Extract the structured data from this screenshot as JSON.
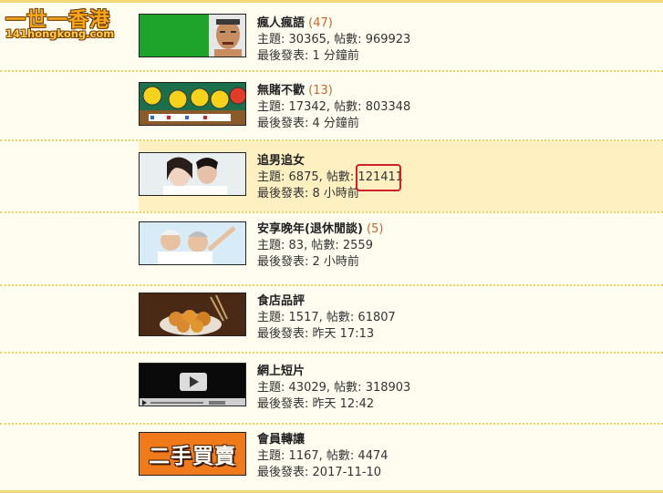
{
  "logo": {
    "main": "一世一香港",
    "sub": "141hongkong.com"
  },
  "labels": {
    "topics": "主題",
    "posts": "帖數",
    "last_post": "最後發表"
  },
  "forums": [
    {
      "name": "瘋人瘋語",
      "new_count": "(47)",
      "topics": "30365",
      "posts": "969923",
      "last_post": "1 分鐘前",
      "thumb": "green-portrait"
    },
    {
      "name": "無賭不歡",
      "new_count": "(13)",
      "topics": "17342",
      "posts": "803348",
      "last_post": "4 分鐘前",
      "thumb": "mahjong-smileys"
    },
    {
      "name": "追男追女",
      "new_count": "",
      "topics": "6875",
      "posts": "121411",
      "last_post": "8 小時前",
      "thumb": "couple"
    },
    {
      "name": "安享晚年(退休閒談)",
      "new_count": "(5)",
      "topics": "83",
      "posts": "2559",
      "last_post": "2 小時前",
      "thumb": "elderly-couple"
    },
    {
      "name": "食店品評",
      "new_count": "",
      "topics": "1517",
      "posts": "61807",
      "last_post": "昨天 17:13",
      "thumb": "food-bowl"
    },
    {
      "name": "網上短片",
      "new_count": "",
      "topics": "43029",
      "posts": "318903",
      "last_post": "昨天 12:42",
      "thumb": "video-player"
    },
    {
      "name": "會員轉讓",
      "new_count": "",
      "topics": "1167",
      "posts": "4474",
      "last_post": "2017-11-10",
      "thumb": "second-hand-sign",
      "thumb_text": "二手買賣"
    }
  ],
  "colors": {
    "accent_border": "#f3d876",
    "count": "#c8682a",
    "highlight_row": "#fff0c2",
    "annotation": "#d0202a"
  }
}
